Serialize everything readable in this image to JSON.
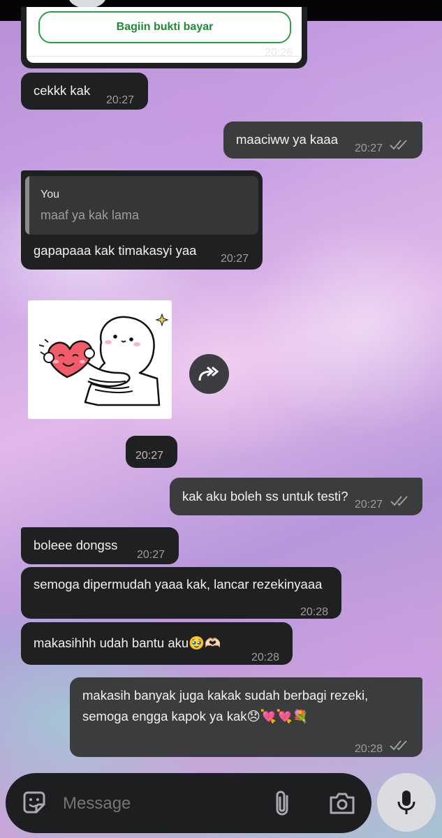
{
  "header": {
    "avatar": "contact-avatar"
  },
  "payment_card": {
    "button_label": "Bagiin bukti bayar",
    "time": "20:26"
  },
  "messages": [
    {
      "dir": "in",
      "text": "cekkk kak",
      "time": "20:27"
    },
    {
      "dir": "out",
      "text": "maaciww ya kaaa",
      "time": "20:27",
      "status": "read"
    },
    {
      "dir": "in",
      "quote_author": "You",
      "quote_text": "maaf ya kak lama",
      "text": "gapapaaa kak timakasyi yaa",
      "time": "20:27"
    },
    {
      "dir": "in",
      "type": "sticker",
      "sticker": "hugging-heart-sticker",
      "time": "20:27"
    },
    {
      "dir": "out",
      "text": "kak aku boleh ss untuk testi?",
      "time": "20:27",
      "status": "read"
    },
    {
      "dir": "in",
      "text": "boleee dongss",
      "time": "20:27"
    },
    {
      "dir": "in",
      "text": "semoga dipermudah yaaa kak, lancar rezekinyaaa",
      "time": "20:28"
    },
    {
      "dir": "in",
      "text": "makasihhh udah bantu aku🥹🫶🏻",
      "time": "20:28"
    },
    {
      "dir": "out",
      "text_line1": "makasih banyak juga kakak sudah berbagi rezeki,",
      "text_line2": "semoga engga kapok ya kak😞💘💘💐",
      "time": "20:28",
      "status": "read"
    }
  ],
  "composer": {
    "placeholder": "Message",
    "icons": [
      "sticker-icon",
      "attach-icon",
      "camera-icon",
      "mic-icon"
    ]
  },
  "colors": {
    "incoming_bubble": "#1f2022",
    "outgoing_bubble": "#3b3c3e",
    "card_button_green": "#2e9e45"
  }
}
